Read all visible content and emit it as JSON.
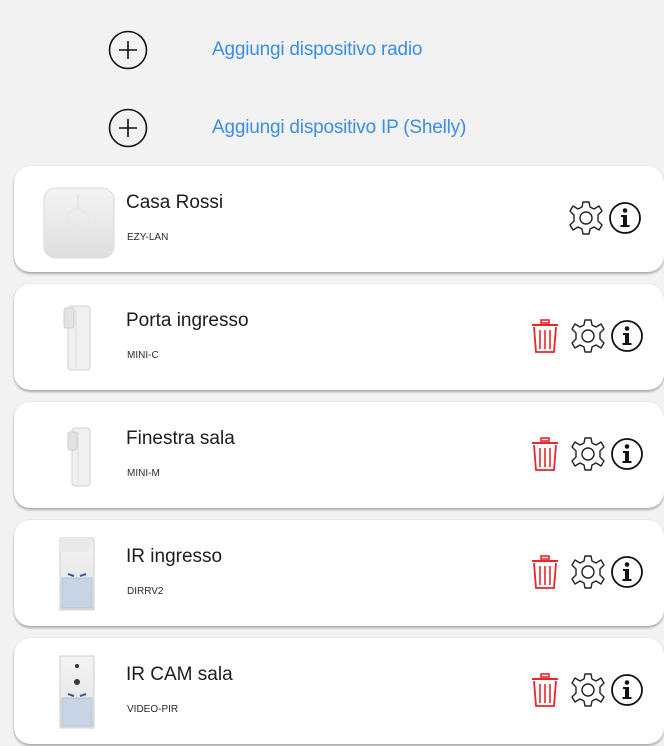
{
  "add_actions": {
    "radio_label": "Aggiungi dispositivo radio",
    "ip_label": "Aggiungi dispositivo IP (Shelly)"
  },
  "devices": [
    {
      "name": "Casa Rossi",
      "model": "EZY-LAN",
      "kind": "hub",
      "deletable": false
    },
    {
      "name": "Porta ingresso",
      "model": "MINI-C",
      "kind": "contact",
      "deletable": true
    },
    {
      "name": "Finestra sala",
      "model": "MINI-M",
      "kind": "contact",
      "deletable": true
    },
    {
      "name": "IR ingresso",
      "model": "DIRRV2",
      "kind": "pir",
      "deletable": true
    },
    {
      "name": "IR CAM sala",
      "model": "VIDEO-PIR",
      "kind": "pir-cam",
      "deletable": true
    }
  ],
  "icons": {
    "add": "plus-circle-icon",
    "delete": "trash-icon",
    "settings": "gear-icon",
    "info": "info-icon"
  },
  "colors": {
    "link": "#3a8ee6",
    "delete": "#e8262b",
    "background": "#f2f2f2",
    "card": "#ffffff"
  }
}
